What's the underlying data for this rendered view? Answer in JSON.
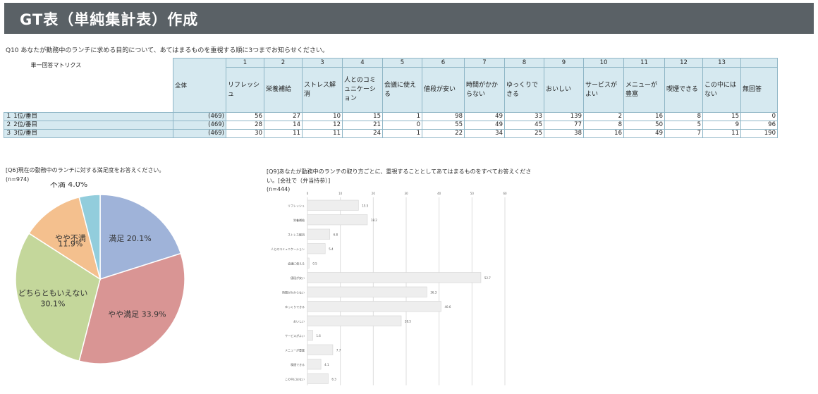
{
  "header": {
    "title": "GT表（単純集計表）作成"
  },
  "q10": {
    "question": "Q10 あなたが勤務中のランチに求める目的について、あてはまるものを重視する順に3つまでお知らせください。",
    "matrix_label": "単一回答マトリクス",
    "total_label": "全体",
    "columns": [
      {
        "num": "1",
        "label": "リフレッシュ"
      },
      {
        "num": "2",
        "label": "栄養補給"
      },
      {
        "num": "3",
        "label": "ストレス解消"
      },
      {
        "num": "4",
        "label": "人とのコミュニケーション"
      },
      {
        "num": "5",
        "label": "会議に使える"
      },
      {
        "num": "6",
        "label": "値段が安い"
      },
      {
        "num": "7",
        "label": "時間がかからない"
      },
      {
        "num": "8",
        "label": "ゆっくりできる"
      },
      {
        "num": "9",
        "label": "おいしい"
      },
      {
        "num": "10",
        "label": "サービスがよい"
      },
      {
        "num": "11",
        "label": "メニューが豊富"
      },
      {
        "num": "12",
        "label": "喫煙できる"
      },
      {
        "num": "13",
        "label": "この中にはない"
      },
      {
        "num": "",
        "label": "無回答"
      }
    ],
    "rows": [
      {
        "label": "１ 1位/番目",
        "total": "(469)",
        "values": [
          "56",
          "27",
          "10",
          "15",
          "1",
          "98",
          "49",
          "33",
          "139",
          "2",
          "16",
          "8",
          "15",
          "0"
        ]
      },
      {
        "label": "２ 2位/番目",
        "total": "(469)",
        "values": [
          "28",
          "14",
          "12",
          "21",
          "0",
          "55",
          "49",
          "45",
          "77",
          "8",
          "50",
          "5",
          "9",
          "96"
        ]
      },
      {
        "label": "３ 3位/番目",
        "total": "(469)",
        "values": [
          "30",
          "11",
          "11",
          "24",
          "1",
          "22",
          "34",
          "25",
          "38",
          "16",
          "49",
          "7",
          "11",
          "190"
        ]
      }
    ]
  },
  "pie": {
    "question": "[Q6]現在の勤務中のランチに対する満足度をお答えください。",
    "n": "(n=974)"
  },
  "bar": {
    "question_line1": "[Q9]あなたが勤務中のランチの取り方ごとに、重視することとしてあてはまるものをすべてお答えくださ",
    "question_line2": "い。[会社で（弁当持参）]",
    "n": "(n=444)"
  },
  "chart_data": [
    {
      "type": "pie",
      "slices": [
        {
          "label": "満足",
          "value": 20.1,
          "value_label": "20.1%",
          "color": "#9fb3d9"
        },
        {
          "label": "やや満足",
          "value": 33.9,
          "value_label": "33.9%",
          "color": "#d99594"
        },
        {
          "label": "どちらともいえない",
          "value": 30.1,
          "value_label": "30.1%",
          "color": "#c4d79b"
        },
        {
          "label": "やや不満",
          "value": 11.9,
          "value_label": "11.9%",
          "color": "#f4c08e"
        },
        {
          "label": "不満",
          "value": 4.0,
          "value_label": "4.0%",
          "color": "#92cddc"
        }
      ]
    },
    {
      "type": "bar",
      "orientation": "horizontal",
      "color": "#eeeeee",
      "xlim": [
        0,
        60
      ],
      "ticks": [
        "0",
        "10",
        "20",
        "30",
        "40",
        "50",
        "60"
      ],
      "categories": [
        "リフレッシュ",
        "栄養補給",
        "ストレス解消",
        "人とのコミュニケーション",
        "会議に使える",
        "値段が安い",
        "時間がかからない",
        "ゆっくりできる",
        "おいしい",
        "サービスがよい",
        "メニューが豊富",
        "喫煙できる",
        "この中にはない"
      ],
      "values": [
        15.5,
        18.2,
        6.8,
        5.4,
        0.5,
        52.7,
        36.3,
        40.6,
        28.5,
        1.6,
        7.7,
        4.1,
        6.3
      ]
    }
  ]
}
